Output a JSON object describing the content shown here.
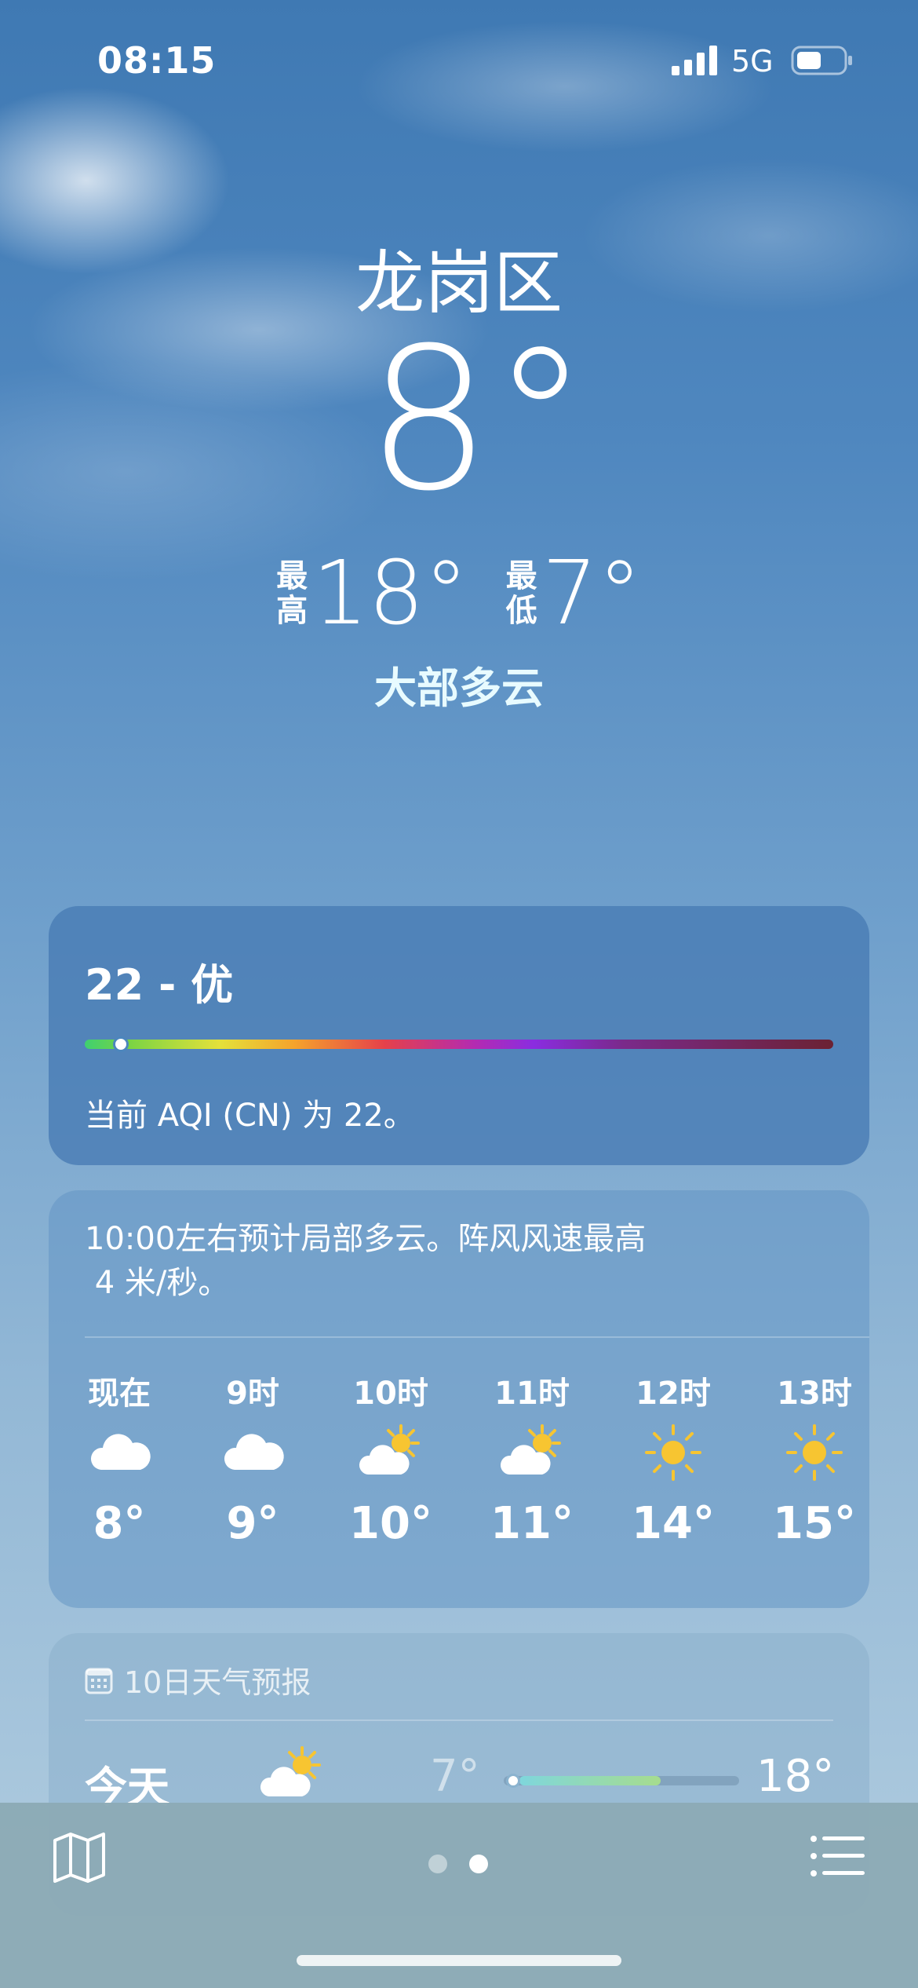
{
  "status_bar": {
    "time": "08:15",
    "network": "5G",
    "icons": [
      "signal-icon",
      "battery-icon"
    ]
  },
  "hero": {
    "location": "龙岗区",
    "temperature": "8°",
    "high_label": [
      "最",
      "高"
    ],
    "high_value": "18°",
    "low_label": [
      "最",
      "低"
    ],
    "low_value": "7°",
    "condition": "大部多云"
  },
  "aqi": {
    "title": "22 - 优",
    "description": "当前 AQI (CN) 为 22。",
    "value": 22,
    "scale_position_fraction": 0.05
  },
  "hourly": {
    "summary_line1": "10:00左右预计局部多云。阵风风速最高",
    "summary_line2": " 4 米/秒。",
    "items": [
      {
        "label": "现在",
        "icon": "cloud-icon",
        "temp": "8°"
      },
      {
        "label": "9时",
        "icon": "cloud-icon",
        "temp": "9°"
      },
      {
        "label": "10时",
        "icon": "partly-sunny-icon",
        "temp": "10°"
      },
      {
        "label": "11时",
        "icon": "partly-sunny-icon",
        "temp": "11°"
      },
      {
        "label": "12时",
        "icon": "sun-icon",
        "temp": "14°"
      },
      {
        "label": "13时",
        "icon": "sun-icon",
        "temp": "15°"
      }
    ]
  },
  "forecast": {
    "header": "10日天气预报",
    "days": [
      {
        "day": "今天",
        "icon": "partly-sunny-icon",
        "low": "7°",
        "high": "18°"
      }
    ]
  },
  "bottom_bar": {
    "icons": [
      "map-icon",
      "list-icon"
    ],
    "pages": 2,
    "active_page": 2
  },
  "colors": {
    "sun": "#f7c531",
    "condition_text": "#e8fbff",
    "card_aqi": "#487cb4"
  }
}
